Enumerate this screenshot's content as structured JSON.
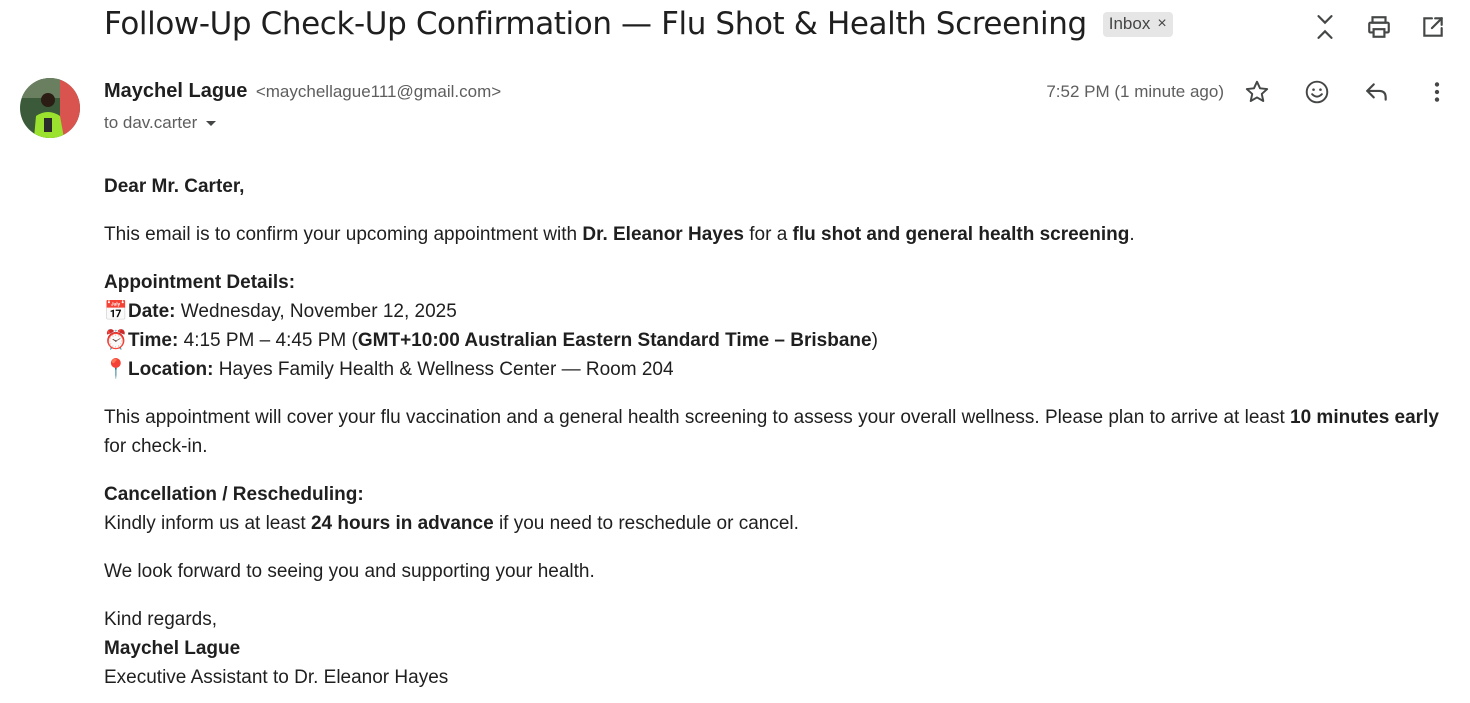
{
  "email": {
    "subject": "Follow-Up Check-Up Confirmation — Flu Shot & Health Screening",
    "label": "Inbox",
    "label_remove": "×",
    "sender_name": "Maychel Lague",
    "sender_email": "<maychellague111@gmail.com>",
    "to": "to dav.carter",
    "timestamp": "7:52 PM (1 minute ago)"
  },
  "icons": {
    "collapse": "collapse-icon",
    "print": "print-icon",
    "open_new_window": "open-in-new-icon",
    "star": "star-icon",
    "emoji": "emoji-icon",
    "reply": "reply-icon",
    "more": "more-vert-icon"
  },
  "body": {
    "greeting": "Dear Mr. Carter,",
    "intro_pre": "This email is to confirm your upcoming appointment with ",
    "intro_doctor": "Dr. Eleanor Hayes",
    "intro_mid": " for a ",
    "intro_service": "flu shot and general health screening",
    "intro_end": ".",
    "details_heading": "Appointment Details:",
    "date_emoji": "📅",
    "date_label": "Date:",
    "date_value": " Wednesday, November 12, 2025",
    "time_emoji": "⏰",
    "time_label": "Time:",
    "time_value": " 4:15 PM – 4:45 PM (",
    "time_zone": "GMT+10:00 Australian Eastern Standard Time – Brisbane",
    "time_close": ")",
    "location_emoji": "📍",
    "location_label": "Location:",
    "location_value": " Hayes Family Health & Wellness Center — Room 204",
    "cover_pre": "This appointment will cover your flu vaccination and a general health screening to assess your overall wellness. Please plan to arrive at least ",
    "cover_bold": "10 minutes early",
    "cover_end": " for check-in.",
    "cancel_heading": "Cancellation / Rescheduling:",
    "cancel_pre": "Kindly inform us at least ",
    "cancel_bold": "24 hours in advance",
    "cancel_end": " if you need to reschedule or cancel.",
    "closing_line": "We look forward to seeing you and supporting your health.",
    "regards": "Kind regards,",
    "signature_name": "Maychel Lague",
    "signature_title": "Executive Assistant to Dr. Eleanor Hayes"
  }
}
